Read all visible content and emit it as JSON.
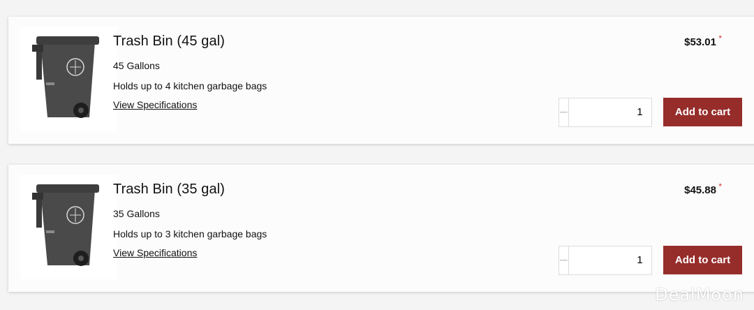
{
  "products": [
    {
      "title": "Trash Bin (45 gal)",
      "capacity": "45 Gallons",
      "description": "Holds up to 4 kitchen garbage bags",
      "spec_link": "View Specifications",
      "price": "$53.01",
      "asterisk": "*",
      "quantity": "1",
      "add_label": "Add to cart",
      "minus_glyph": "−",
      "plus_glyph": "+"
    },
    {
      "title": "Trash Bin (35 gal)",
      "capacity": "35 Gallons",
      "description": "Holds up to 3 kitchen garbage bags",
      "spec_link": "View Specifications",
      "price": "$45.88",
      "asterisk": "*",
      "quantity": "1",
      "add_label": "Add to cart",
      "minus_glyph": "−",
      "plus_glyph": "+"
    }
  ],
  "watermark": "DealMoon",
  "colors": {
    "accent": "#962d2b",
    "asterisk": "#d0342c",
    "bin": "#4a4a4a"
  }
}
